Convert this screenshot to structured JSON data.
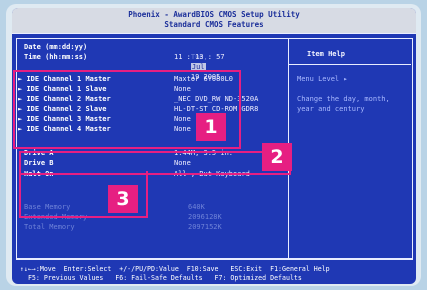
{
  "header": {
    "line1": "Phoenix - AwardBIOS CMOS Setup Utility",
    "line2": "Standard CMOS Features"
  },
  "date": {
    "label": "Date (mm:dd:yy)",
    "weekday": "Tue,",
    "month": "Jul",
    "day_year": "19 2005"
  },
  "time": {
    "label": "Time (hh:mm:ss)",
    "value": "11 : 13 : 57"
  },
  "ide": [
    {
      "label": "IDE Channel 1 Master",
      "value": "Maxtor 6Y080L0"
    },
    {
      "label": "IDE Channel 1 Slave",
      "value": "None"
    },
    {
      "label": "IDE Channel 2 Master",
      "value": "_NEC DVD_RW ND-3520A"
    },
    {
      "label": "IDE Channel 2 Slave",
      "value": "HL-DT-ST CD-ROM GDR8"
    },
    {
      "label": "IDE Channel 3 Master",
      "value": "None"
    },
    {
      "label": "IDE Channel 4 Master",
      "value": "None"
    }
  ],
  "drives": [
    {
      "label": "Drive A",
      "value": "1.44M, 3.5 in."
    },
    {
      "label": "Drive B",
      "value": "None"
    },
    {
      "label": "Halt On",
      "value": "All , But Keyboard"
    }
  ],
  "memory": [
    {
      "label": "Base Memory",
      "value": "640K"
    },
    {
      "label": "Extended Memory",
      "value": "2096128K"
    },
    {
      "label": "Total Memory",
      "value": "2097152K"
    }
  ],
  "help": {
    "title": "Item Help",
    "menu_level": "Menu Level  ▸",
    "text": "Change the day, month, year and century"
  },
  "footer": {
    "row1": "↑↓←→:Move  Enter:Select  +/-/PU/PD:Value  F10:Save   ESC:Exit  F1:General Help",
    "row2": "  F5: Previous Values   F6: Fail-Safe Defaults   F7: Optimized Defaults"
  },
  "badges": {
    "one": "1",
    "two": "2",
    "three": "3"
  },
  "colors": {
    "bios_blue": "#1f38b4",
    "highlight_magenta": "#e61f82"
  }
}
